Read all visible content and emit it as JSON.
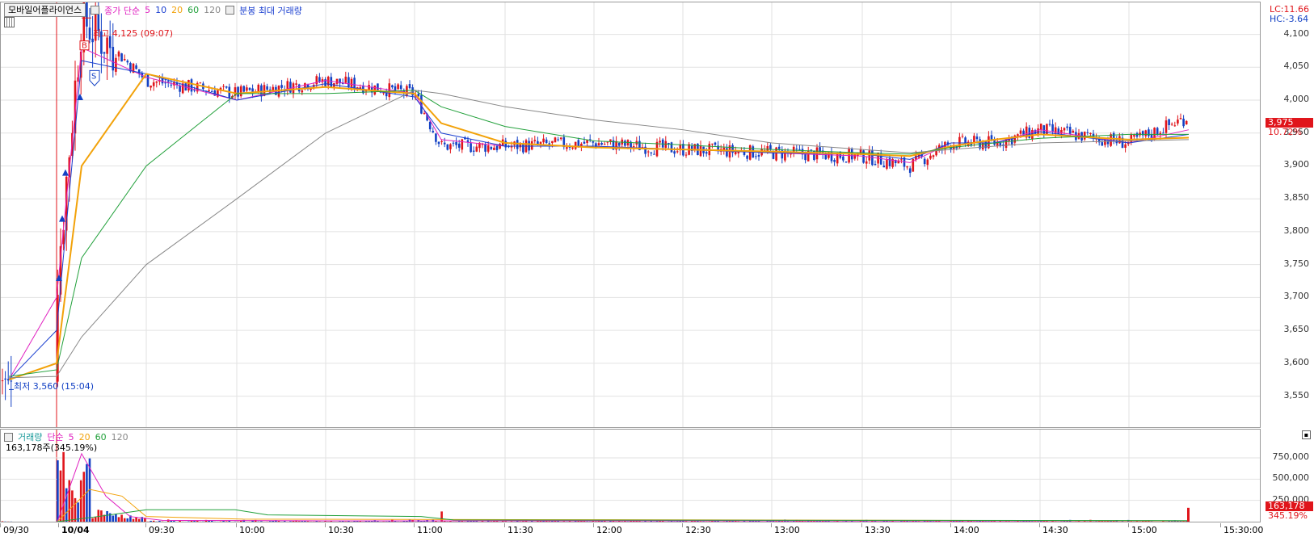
{
  "header": {
    "symbol": "모바일어플라이언스",
    "ma_type": "종가 단순",
    "ma_periods": [
      "5",
      "10",
      "20",
      "60",
      "120"
    ],
    "extra_label": "분봉 최대 거래량",
    "lc": "LC:11.66",
    "hc": "HC:-3.64"
  },
  "colors": {
    "up": "#e0151b",
    "down": "#1341c4",
    "ma5": "#e020c0",
    "ma10": "#1a3fd0",
    "ma20": "#f2a20a",
    "ma60": "#21a03a",
    "ma120": "#888888"
  },
  "annotations": {
    "high": "최고 4,125 (09:07)",
    "low": "최저 3,560 (15:04)",
    "buy_marker": "B",
    "sell_marker": "S"
  },
  "price_axis": {
    "ticks": [
      "4,100",
      "4,050",
      "4,000",
      "3,950",
      "3,900",
      "3,850",
      "3,800",
      "3,750",
      "3,700",
      "3,650",
      "3,600",
      "3,550"
    ],
    "current_price": "3,975",
    "change_pct": "10.72%"
  },
  "volume_pane": {
    "title": "거래량",
    "ma_type": "단순",
    "ma_periods": [
      "5",
      "20",
      "60",
      "120"
    ],
    "info": "163,178주(345.19%)",
    "ticks": [
      "750,000",
      "500,000",
      "250,000"
    ],
    "current_volume": "163,178",
    "current_pct": "345.19%"
  },
  "time_axis": {
    "labels": [
      "09/30",
      "10/04",
      "09:30",
      "10:00",
      "10:30",
      "11:00",
      "11:30",
      "12:00",
      "12:30",
      "13:00",
      "13:30",
      "14:00",
      "14:30",
      "15:00",
      "15:30:00"
    ]
  },
  "chart_data": {
    "type": "candlestick",
    "price_range": [
      3520,
      4140
    ],
    "volume_range": [
      0,
      950000
    ],
    "series": [
      {
        "name": "종가",
        "x": [
          "09/30 15:04",
          "10/04 09:00",
          "09:07",
          "09:30",
          "10:00",
          "10:30",
          "11:00",
          "11:05",
          "11:30",
          "12:00",
          "12:30",
          "13:00",
          "13:30",
          "13:45",
          "14:00",
          "14:15",
          "14:30",
          "15:00",
          "15:15"
        ],
        "values": [
          3575,
          3720,
          4125,
          4030,
          4010,
          4030,
          4010,
          3930,
          3930,
          3935,
          3925,
          3920,
          3915,
          3900,
          3935,
          3935,
          3955,
          3935,
          3975
        ]
      },
      {
        "name": "5",
        "values": [
          3575,
          3700,
          4080,
          4035,
          4000,
          4030,
          4010,
          3940,
          3930,
          3930,
          3925,
          3920,
          3915,
          3905,
          3935,
          3935,
          3955,
          3935,
          3955
        ]
      },
      {
        "name": "10",
        "values": [
          3575,
          3650,
          4060,
          4040,
          4000,
          4025,
          4005,
          3950,
          3930,
          3930,
          3925,
          3920,
          3918,
          3910,
          3935,
          3935,
          3952,
          3935,
          3948
        ]
      },
      {
        "name": "20",
        "values": [
          3575,
          3600,
          3900,
          4040,
          4010,
          4020,
          4010,
          3965,
          3935,
          3928,
          3925,
          3922,
          3918,
          3915,
          3930,
          3940,
          3948,
          3940,
          3943
        ]
      },
      {
        "name": "60",
        "values": [
          3580,
          3590,
          3760,
          3900,
          4010,
          4010,
          4015,
          3990,
          3960,
          3938,
          3932,
          3925,
          3920,
          3918,
          3928,
          3935,
          3942,
          3948,
          3948
        ]
      },
      {
        "name": "120",
        "values": [
          3578,
          3580,
          3640,
          3750,
          3850,
          3950,
          4015,
          4010,
          3990,
          3970,
          3955,
          3935,
          3925,
          3920,
          3925,
          3930,
          3935,
          3938,
          3940
        ]
      }
    ],
    "volume": [
      0,
      820000,
      830000,
      120000,
      60000,
      40000,
      30000,
      15000,
      12000,
      8000,
      6000,
      6000,
      8000,
      12000,
      10000,
      12000,
      14000,
      20000,
      163178
    ]
  }
}
